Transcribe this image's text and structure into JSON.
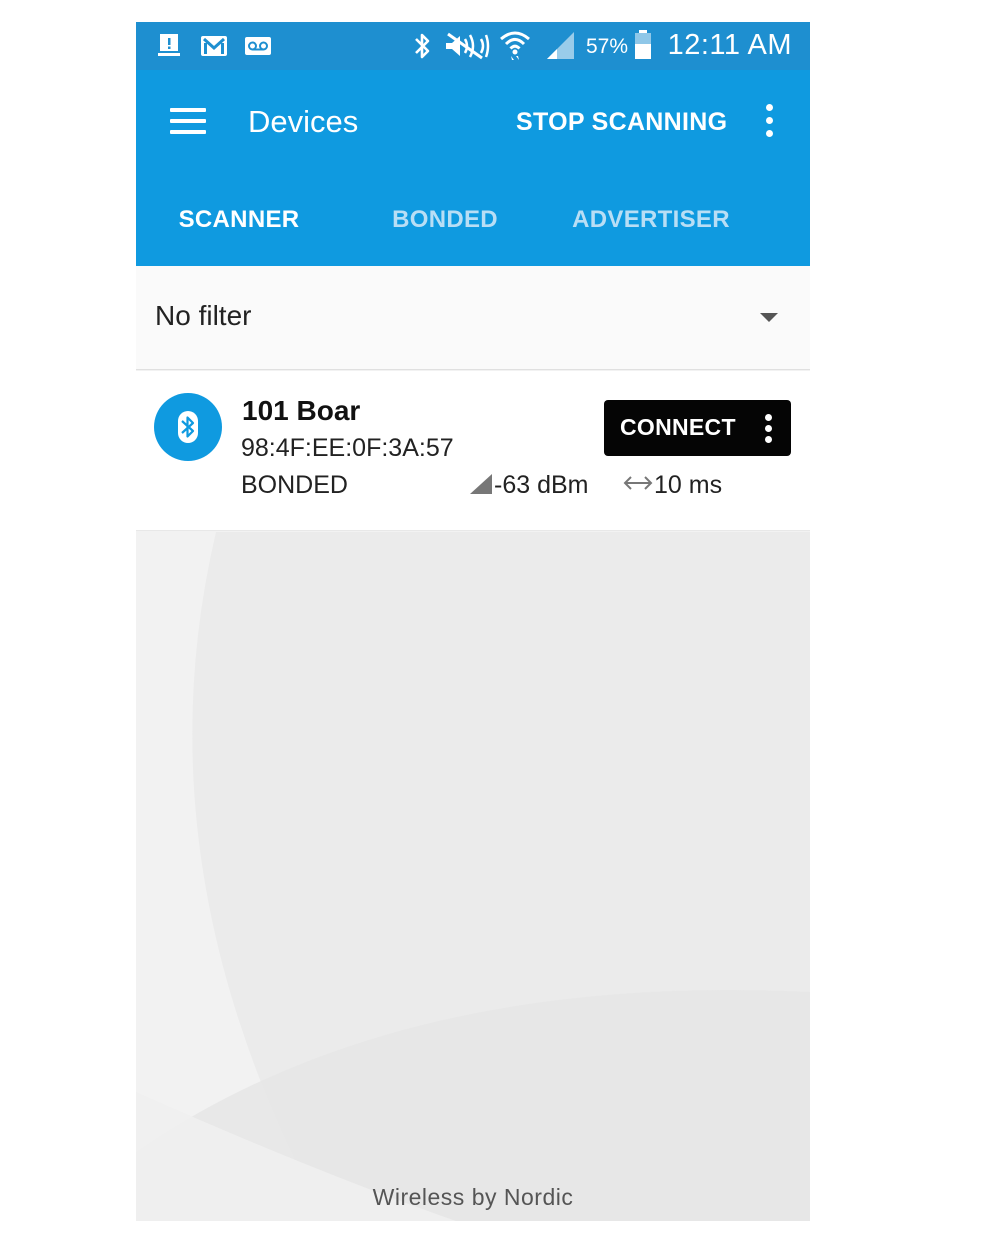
{
  "status_bar": {
    "icons": [
      "notification-icon",
      "gmail-icon",
      "voicemail-icon",
      "bluetooth-icon",
      "mute-icon",
      "wifi-icon",
      "signal-icon",
      "battery-icon"
    ],
    "battery_percent": "57%",
    "time": "12:11 AM"
  },
  "app_bar": {
    "title": "Devices",
    "action": "STOP SCANNING",
    "color": "#0f9ae0"
  },
  "tabs": [
    {
      "label": "SCANNER",
      "selected": true
    },
    {
      "label": "BONDED",
      "selected": false
    },
    {
      "label": "ADVERTISER",
      "selected": false
    }
  ],
  "filter": {
    "value": "No filter"
  },
  "devices": [
    {
      "name": "101 Boar",
      "address": "98:4F:EE:0F:3A:57",
      "bond_state": "BONDED",
      "rssi": "-63 dBm",
      "interval": "10 ms",
      "action": "CONNECT"
    }
  ],
  "footer": {
    "brand": "Wireless by Nordic"
  }
}
